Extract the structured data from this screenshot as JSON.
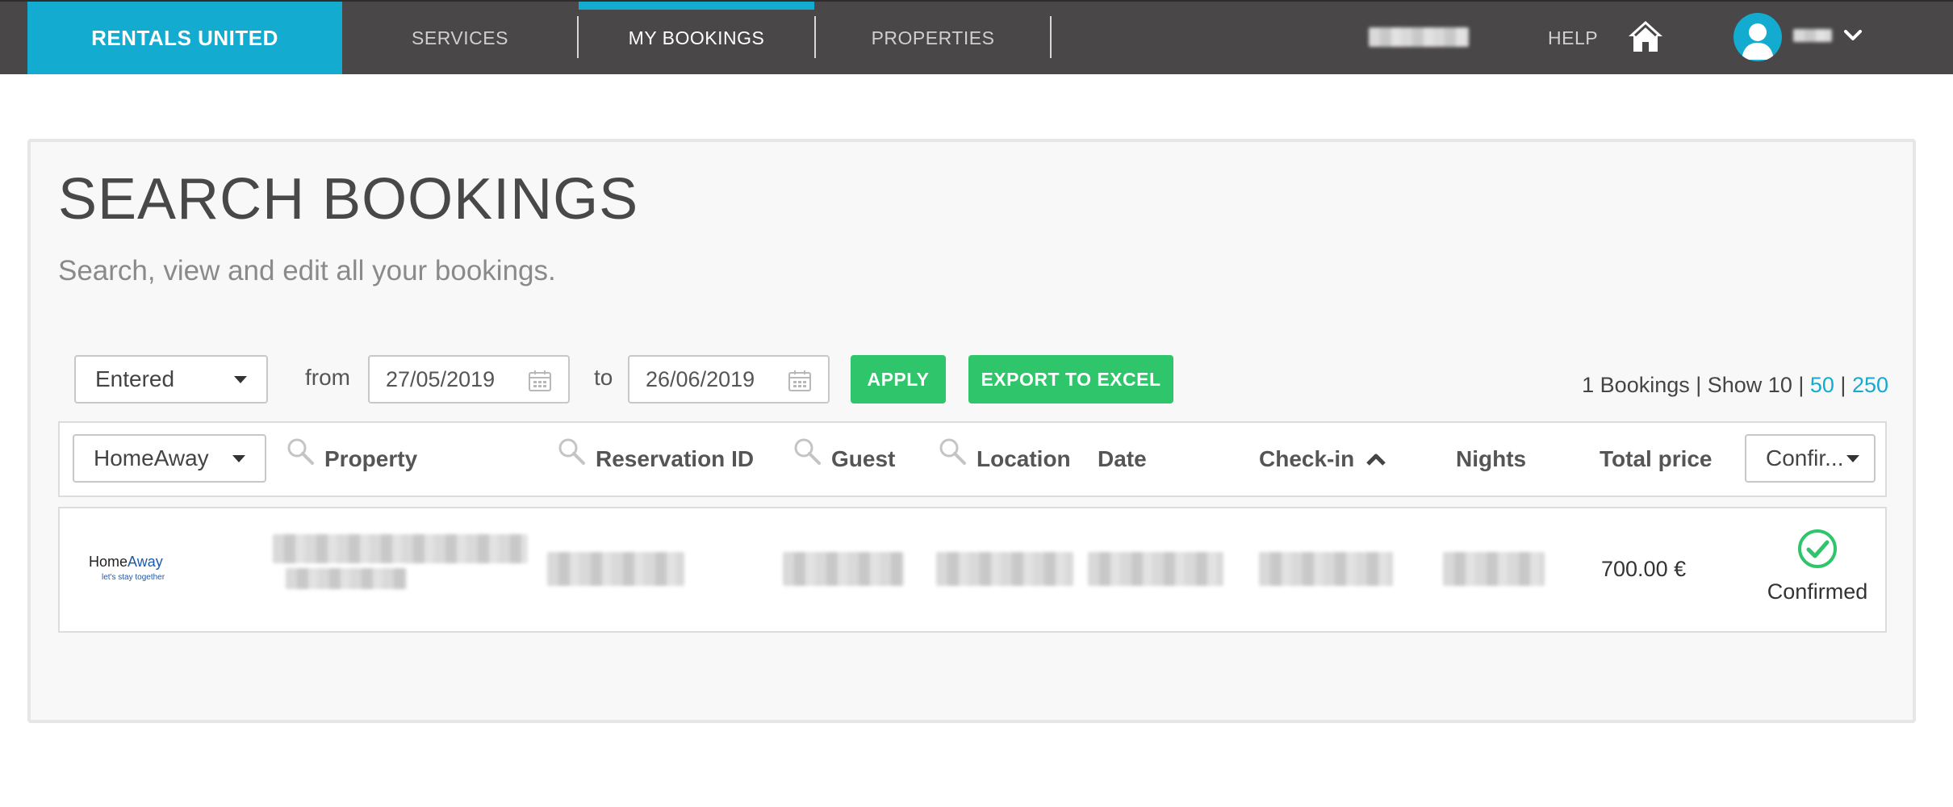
{
  "nav": {
    "brand": "RENTALS UNITED",
    "items": [
      {
        "label": "SERVICES"
      },
      {
        "label": "MY BOOKINGS"
      },
      {
        "label": "PROPERTIES"
      }
    ],
    "help": "HELP",
    "accent_color": "#13abcf"
  },
  "page": {
    "title": "SEARCH BOOKINGS",
    "subtitle": "Search, view and edit all your bookings."
  },
  "filters": {
    "date_type": "Entered",
    "from_label": "from",
    "from_value": "27/05/2019",
    "to_label": "to",
    "to_value": "26/06/2019",
    "apply_label": "APPLY",
    "export_label": "EXPORT TO EXCEL"
  },
  "results": {
    "count_text": "1 Bookings | Show 10 | ",
    "show_50": "50",
    "separator": " | ",
    "show_250": "250"
  },
  "table": {
    "channel_filter": "HomeAway",
    "status_filter": "Confir...",
    "headers": {
      "property": "Property",
      "reservation_id": "Reservation ID",
      "guest": "Guest",
      "location": "Location",
      "date": "Date",
      "checkin": "Check-in",
      "nights": "Nights",
      "total_price": "Total price"
    },
    "rows": [
      {
        "channel_logo": "HomeAway",
        "channel_logo_prefix": "Home",
        "channel_logo_suffix": "Away",
        "channel_tagline": "let's stay together",
        "total_price": "700.00 €",
        "status": "Confirmed",
        "status_icon": "check-circle-icon"
      }
    ]
  },
  "colors": {
    "nav_bg": "#4a4748",
    "button_green": "#2ec56b",
    "link": "#13abcf"
  }
}
